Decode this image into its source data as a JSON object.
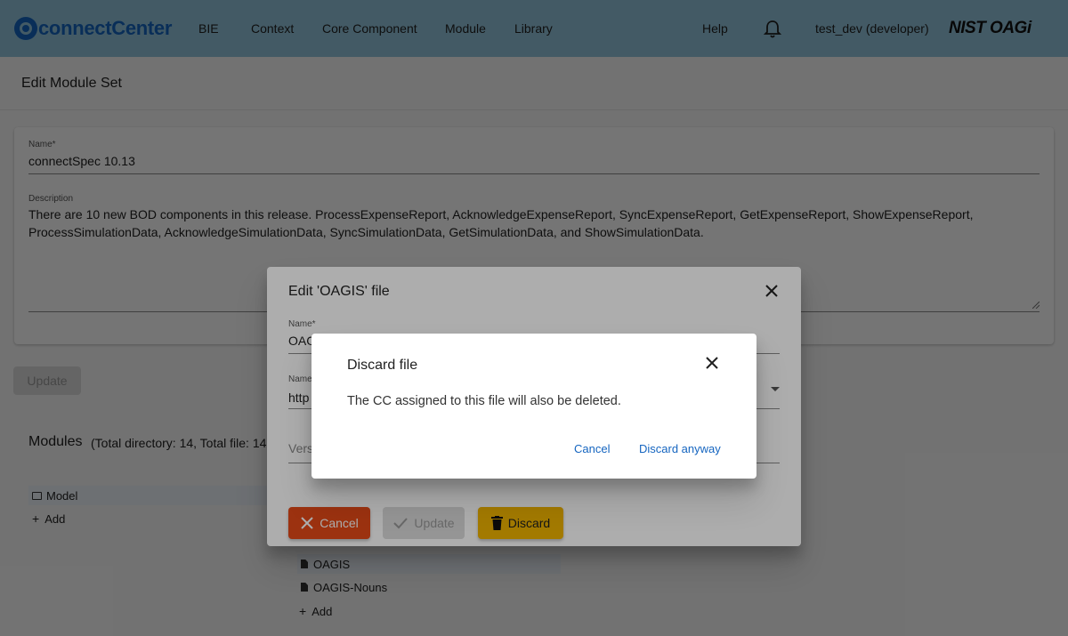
{
  "header": {
    "logo_text": "connectCenter",
    "nav": [
      "BIE",
      "Context",
      "Core Component",
      "Module",
      "Library"
    ],
    "help": "Help",
    "user": "test_dev (developer)",
    "brand": "NIST OAGi"
  },
  "page": {
    "title": "Edit Module Set",
    "name_label": "Name*",
    "name_value": "connectSpec 10.13",
    "description_label": "Description",
    "description_value": "There are 10 new BOD components in this release. ProcessExpenseReport, AcknowledgeExpenseReport, SyncExpenseReport, GetExpenseReport, ShowExpenseReport, ProcessSimulationData, AcknowledgeSimulationData, SyncSimulationData, GetSimulationData, and ShowSimulationData.",
    "update_button": "Update"
  },
  "modules": {
    "title": "Modules",
    "summary": "(Total directory: 14, Total file: 14",
    "left_tree": [
      "Model",
      "Add"
    ],
    "right_tree": [
      "OAGIS",
      "OAGIS-Nouns",
      "Add"
    ]
  },
  "edit_dialog": {
    "title": "Edit 'OAGIS' file",
    "name_label": "Name*",
    "name_value": "OAG",
    "namespace_label": "Name",
    "namespace_value": "http",
    "version_placeholder": "Vers",
    "cancel": "Cancel",
    "update": "Update",
    "discard": "Discard"
  },
  "confirm_dialog": {
    "title": "Discard file",
    "message": "The CC assigned to this file will also be deleted.",
    "cancel": "Cancel",
    "confirm": "Discard anyway"
  },
  "colors": {
    "topbar": "#92c5dc",
    "primary": "#1565c0",
    "cancel_btn": "#e64a19",
    "discard_btn": "#f0b400"
  }
}
